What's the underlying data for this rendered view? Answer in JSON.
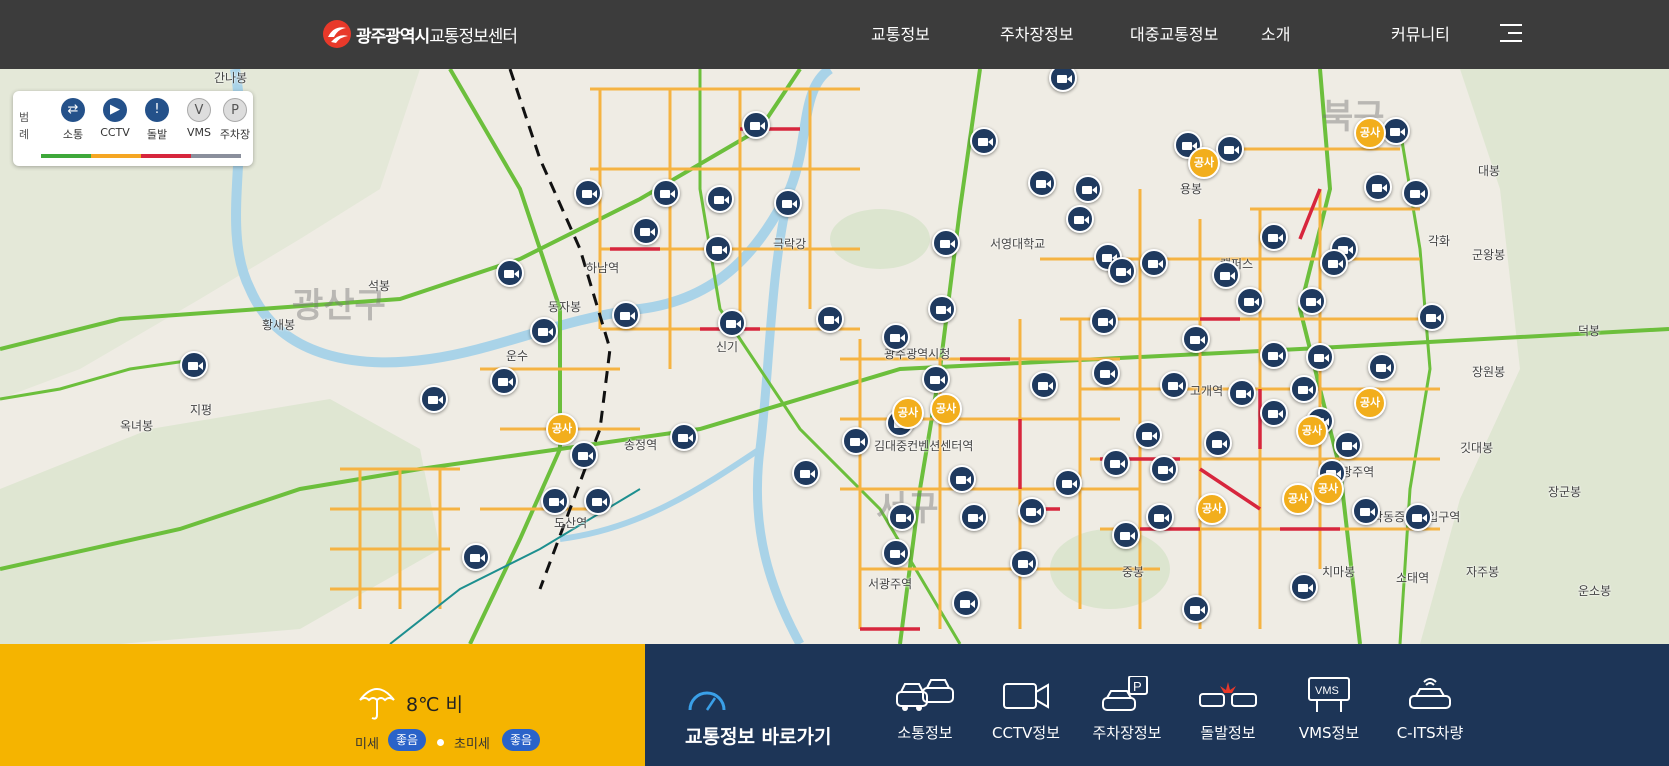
{
  "header": {
    "logo_city": "광주광역시",
    "logo_center": "교통정보센터",
    "nav": [
      "교통정보",
      "주차장정보",
      "대중교통정보",
      "소개",
      "커뮤니티"
    ]
  },
  "legend": {
    "title": "범례",
    "items": [
      {
        "label": "소통",
        "icon": "traffic-flow-icon"
      },
      {
        "label": "CCTV",
        "icon": "cctv-icon"
      },
      {
        "label": "돌발",
        "icon": "incident-icon"
      },
      {
        "label": "VMS",
        "icon": "vms-icon"
      },
      {
        "label": "주차장",
        "icon": "parking-icon"
      }
    ],
    "bar_colors": [
      "#3ea83a",
      "#f5a623",
      "#d7263d",
      "#8a8f9c"
    ]
  },
  "map": {
    "districts": [
      "광산구",
      "북구",
      "서구"
    ],
    "places": [
      "간나봉",
      "석봉",
      "황새봉",
      "옥녀봉",
      "동자봉",
      "하남역",
      "운수",
      "지평",
      "극락강",
      "신기",
      "송정역",
      "도산역",
      "광주광역시청",
      "김대중컨벤션센터역",
      "서광주역",
      "서영대학교",
      "용봉",
      "캠퍼스",
      "고개역",
      "남광주역",
      "학동증심사입구역",
      "치마봉",
      "소태역",
      "중봉",
      "대봉",
      "군왕봉",
      "덕봉",
      "장원봉",
      "깃대봉",
      "장군봉",
      "자주봉",
      "운소봉",
      "각화"
    ],
    "work_label": "공사"
  },
  "weather": {
    "temperature": "8℃",
    "condition": "비",
    "pm10_label": "미세",
    "pm10_status": "좋음",
    "pm25_label": "초미세",
    "pm25_status": "좋음"
  },
  "shortcut": {
    "title": "교통정보 바로가기",
    "links": [
      {
        "label": "소통정보",
        "icon": "cars-icon"
      },
      {
        "label": "CCTV정보",
        "icon": "camera-icon"
      },
      {
        "label": "주차장정보",
        "icon": "parking-car-icon"
      },
      {
        "label": "돌발정보",
        "icon": "crash-icon"
      },
      {
        "label": "VMS정보",
        "icon": "vms-board-icon"
      },
      {
        "label": "C-ITS차량",
        "icon": "connected-car-icon"
      }
    ]
  },
  "colors": {
    "header_bg": "#3c3c3c",
    "weather_bg": "#f5b400",
    "shortcut_bg": "#1d3557",
    "cctv_marker": "#1f3a5f",
    "work_marker": "#f2ae1c"
  }
}
